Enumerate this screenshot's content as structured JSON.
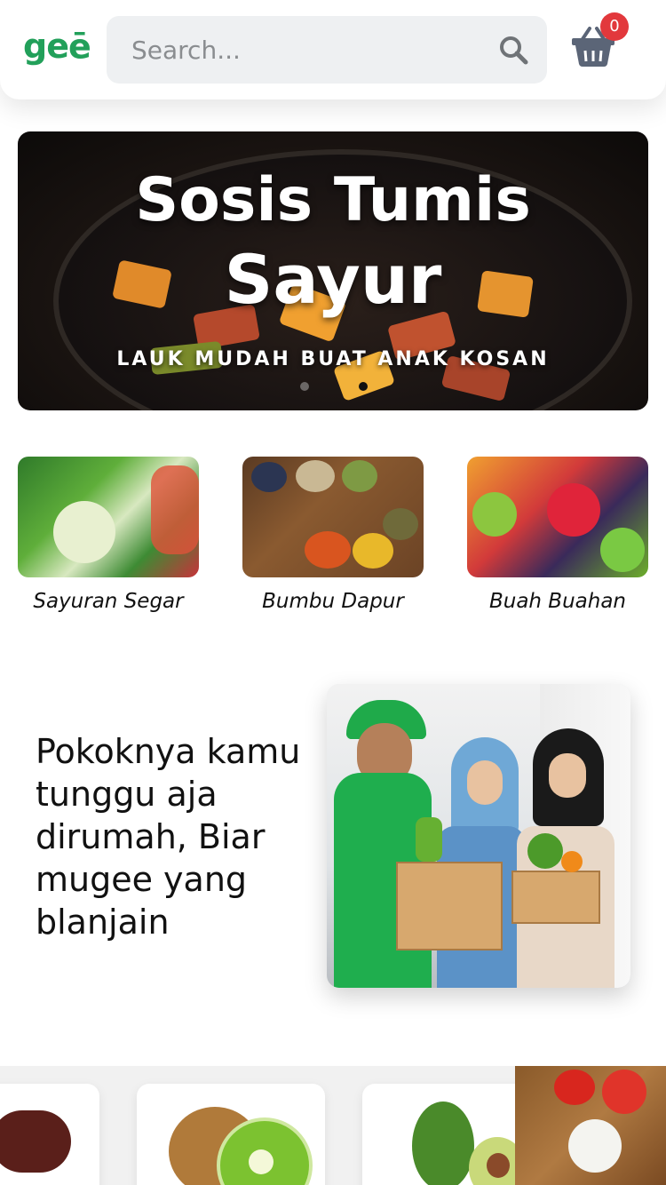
{
  "header": {
    "logo_text": "geē",
    "search_placeholder": "Search...",
    "cart_count": "0",
    "brand_color": "#22a05a"
  },
  "banner": {
    "title_line1": "Sosis Tumis",
    "title_line2": "Sayur",
    "subtitle": "LAUK MUDAH BUAT ANAK KOSAN",
    "active_dot": 2
  },
  "categories": [
    {
      "label": "Sayuran Segar",
      "icon": "vegetables-image"
    },
    {
      "label": "Bumbu Dapur",
      "icon": "spices-image"
    },
    {
      "label": "Buah Buahan",
      "icon": "fruits-image"
    }
  ],
  "promo": {
    "text": "Pokoknya kamu tunggu aja dirumah, Biar mugee yang blanjain"
  }
}
